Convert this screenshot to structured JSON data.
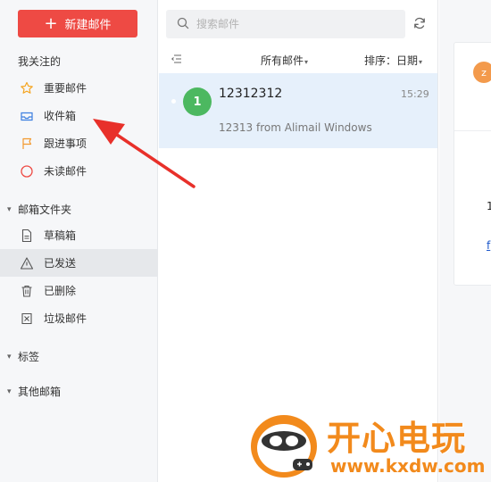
{
  "sidebar": {
    "new_mail_label": "新建邮件",
    "followed_title": "我关注的",
    "followed_items": [
      {
        "label": "重要邮件",
        "icon": "star-icon"
      },
      {
        "label": "收件箱",
        "icon": "inbox-icon"
      },
      {
        "label": "跟进事项",
        "icon": "flag-icon"
      },
      {
        "label": "未读邮件",
        "icon": "circle-icon"
      }
    ],
    "folders_title": "邮箱文件夹",
    "folder_items": [
      {
        "label": "草稿箱",
        "icon": "draft-icon"
      },
      {
        "label": "已发送",
        "icon": "sent-icon",
        "active": true
      },
      {
        "label": "已删除",
        "icon": "trash-icon"
      },
      {
        "label": "垃圾邮件",
        "icon": "spam-icon"
      }
    ],
    "tags_title": "标签",
    "other_title": "其他邮箱"
  },
  "list": {
    "search_placeholder": "搜索邮件",
    "filter_label": "所有邮件",
    "sort_label": "排序：日期",
    "mails": [
      {
        "avatar_letter": "1",
        "sender": "12312312",
        "time": "15:29",
        "preview": "12313 from Alimail Windows"
      }
    ]
  },
  "reader": {
    "avatar_letter": "z",
    "body_text_fragment": "1",
    "link_text_fragment": "f"
  },
  "watermark": {
    "brand": "开心电玩",
    "url": "www.kxdw.com"
  },
  "colors": {
    "accent_red": "#ee4a44",
    "selected_row": "#e6f0fb",
    "avatar_green": "#4cb860",
    "avatar_orange": "#f39a4c",
    "annotation_red": "#e8302a",
    "watermark_orange": "#f28a1c"
  }
}
